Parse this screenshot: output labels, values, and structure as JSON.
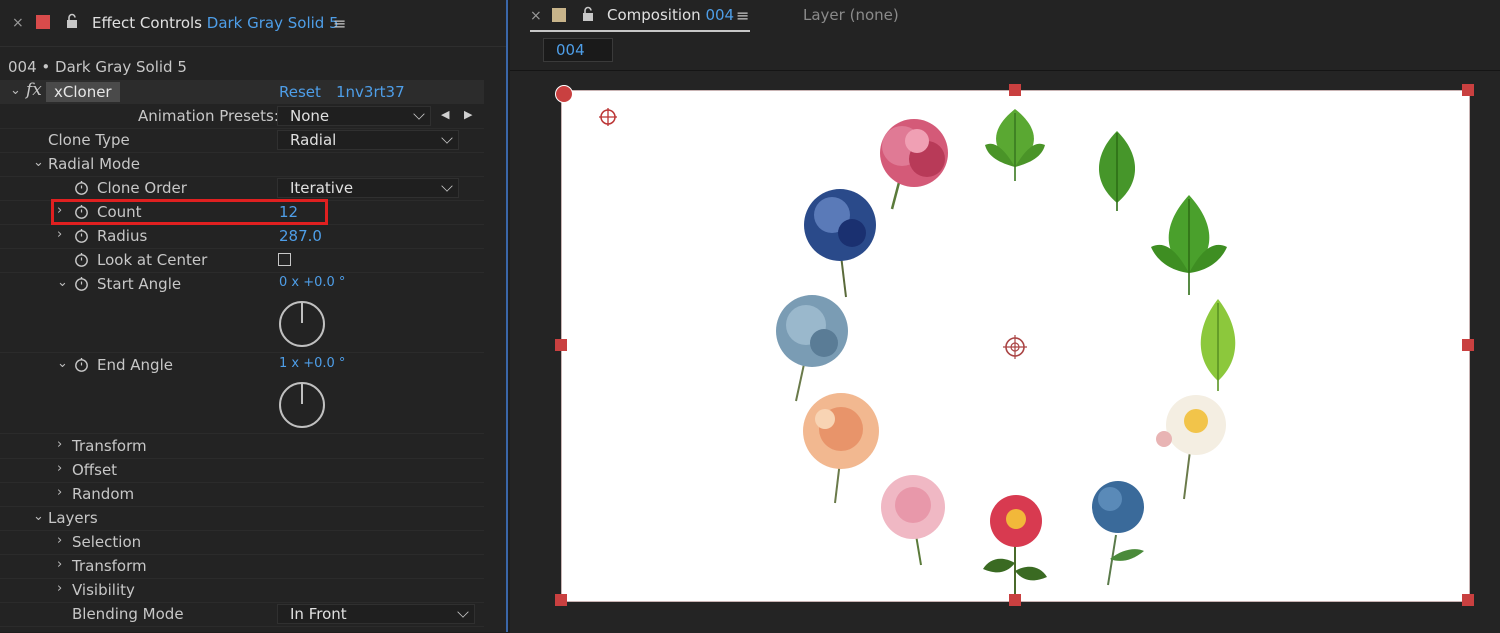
{
  "effect_panel": {
    "tab_prefix": "Effect Controls",
    "tab_layer": "Dark Gray Solid 5",
    "menu_icon": "≡",
    "layer_path": "004 • Dark Gray Solid 5",
    "effect_name": "xCloner",
    "reset_label": "Reset",
    "author_label": "1nv3rt37",
    "animation_presets_label": "Animation Presets:",
    "animation_presets_value": "None",
    "clone_type_label": "Clone Type",
    "clone_type_value": "Radial",
    "radial_mode_label": "Radial Mode",
    "clone_order_label": "Clone Order",
    "clone_order_value": "Iterative",
    "count_label": "Count",
    "count_value": "12",
    "radius_label": "Radius",
    "radius_value": "287.0",
    "look_at_center_label": "Look at Center",
    "start_angle_label": "Start Angle",
    "start_angle_value": "0 x +0.0 °",
    "end_angle_label": "End Angle",
    "end_angle_value": "1 x +0.0 °",
    "transform_label": "Transform",
    "offset_label": "Offset",
    "random_label": "Random",
    "layers_label": "Layers",
    "selection_label": "Selection",
    "layers_transform_label": "Transform",
    "visibility_label": "Visibility",
    "blending_mode_label": "Blending Mode",
    "blending_mode_value": "In Front"
  },
  "composition_panel": {
    "tab_prefix": "Composition",
    "tab_name": "004",
    "menu_icon": "≡",
    "layer_tab": "Layer  (none)",
    "subtab": "004"
  },
  "colors": {
    "accent_blue": "#4e9ee8",
    "highlight_red": "#e02020",
    "handle_red": "#c94040"
  }
}
